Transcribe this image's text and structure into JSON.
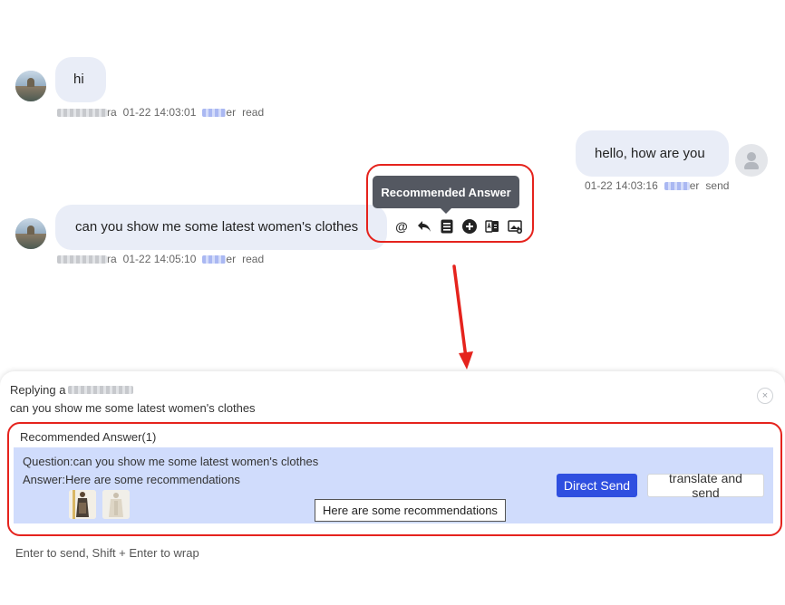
{
  "messages": [
    {
      "side": "left",
      "text": "hi",
      "sender_suffix": "ra",
      "time": "01-22 14:03:01",
      "agent_suffix": "er",
      "status": "read"
    },
    {
      "side": "right",
      "text": "hello, how are you",
      "time": "01-22 14:03:16",
      "agent_suffix": "er",
      "status": "send"
    },
    {
      "side": "left",
      "text": "can you show me some latest women's clothes",
      "sender_suffix": "ra",
      "time": "01-22 14:05:10",
      "agent_suffix": "er",
      "status": "read"
    }
  ],
  "tooltip": {
    "label": "Recommended Answer"
  },
  "toolbar": {
    "icons": [
      "at-icon",
      "reply-icon",
      "recommended-answer-icon",
      "add-circle-icon",
      "translate-icon",
      "image-icon"
    ],
    "at_symbol": "@"
  },
  "reply_panel": {
    "replying_prefix": "Replying a",
    "quoted_text": "can you show me some latest women's clothes",
    "close_symbol": "×"
  },
  "recommended": {
    "header": "Recommended Answer(1)",
    "question": "Question:can you show me some latest women's clothes",
    "answer": "Answer:Here are some recommendations",
    "direct_send": "Direct Send",
    "translate_send": "translate and send",
    "hover_tip": "Here are some recommendations"
  },
  "input": {
    "hint": "Enter to send, Shift + Enter to wrap"
  },
  "colors": {
    "bubble": "#e9edf7",
    "highlight": "#e5231d",
    "primary": "#2f4fe0",
    "card": "#d0dcfc"
  }
}
